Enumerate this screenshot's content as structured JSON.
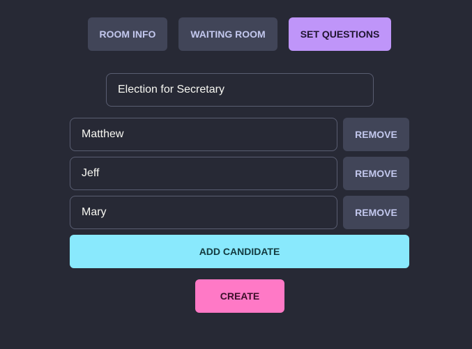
{
  "tabs": [
    {
      "label": "ROOM INFO"
    },
    {
      "label": "WAITING ROOM"
    },
    {
      "label": "SET QUESTIONS"
    }
  ],
  "election_title": {
    "value": "Election for Secretary"
  },
  "candidates": [
    {
      "name": "Matthew",
      "remove_label": "REMOVE"
    },
    {
      "name": "Jeff",
      "remove_label": "REMOVE"
    },
    {
      "name": "Mary",
      "remove_label": "REMOVE"
    }
  ],
  "add_candidate_label": "ADD CANDIDATE",
  "create_label": "CREATE",
  "colors": {
    "background": "#272935",
    "tab_inactive": "#414558",
    "tab_active": "#bf95f9",
    "add_button": "#89e9fd",
    "create_button": "#ff79c6"
  }
}
